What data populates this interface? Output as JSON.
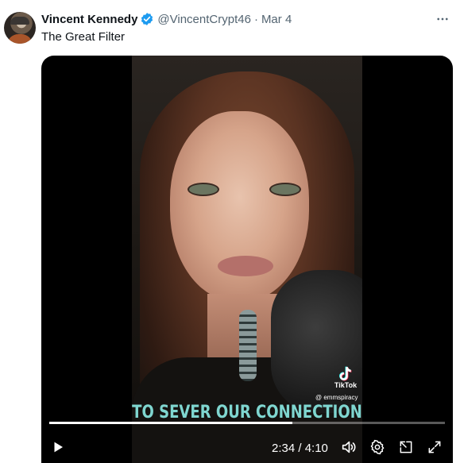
{
  "tweet": {
    "display_name": "Vincent Kennedy",
    "handle": "@VincentCrypt46",
    "separator": "·",
    "date": "Mar 4",
    "text": "The Great Filter"
  },
  "video": {
    "caption": "TO SEVER OUR CONNECTION",
    "watermark_brand": "TikTok",
    "watermark_user": "@ emmspiracy",
    "current_time": "2:34",
    "duration": "4:10",
    "time_display": "2:34 / 4:10",
    "progress_fraction": 0.615
  },
  "icons": {
    "verified": "verified-badge-icon",
    "more": "more-options-icon",
    "play": "play-icon",
    "volume": "volume-icon",
    "settings": "settings-gear-icon",
    "pip": "picture-in-picture-icon",
    "fullscreen": "fullscreen-icon"
  },
  "colors": {
    "verified_blue": "#1d9bf0",
    "secondary_text": "#536471",
    "caption_teal": "#7fd6d0"
  }
}
